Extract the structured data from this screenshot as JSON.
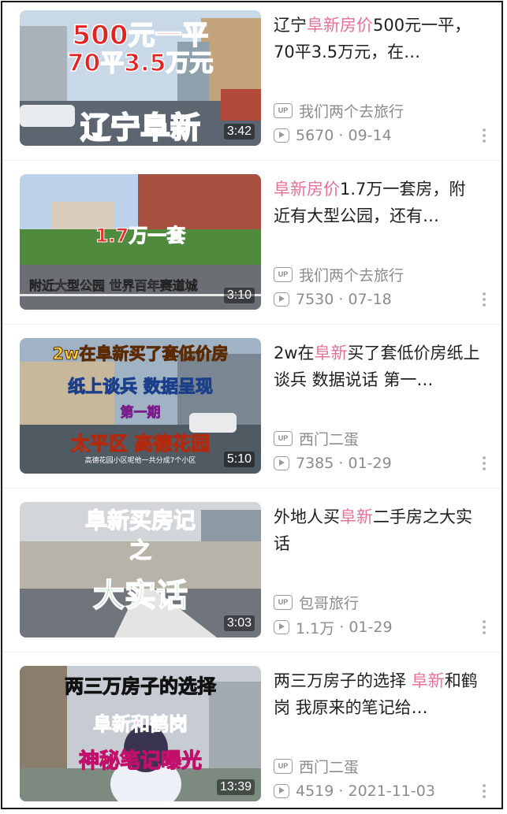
{
  "videos": [
    {
      "thumbnail_captions": [
        "500元一平",
        "70平3.5万元",
        "辽宁阜新"
      ],
      "duration": "3:42",
      "title_parts": [
        {
          "text": "辽宁",
          "highlight": false
        },
        {
          "text": "阜新房价",
          "highlight": true
        },
        {
          "text": "500元一平，70平3.5万元，在…",
          "highlight": false
        }
      ],
      "uploader": "我们两个去旅行",
      "views": "5670",
      "date": "09-14"
    },
    {
      "thumbnail_captions": [
        "1.7万一套",
        "附近大型公园  世界百年赛道城"
      ],
      "duration": "3:10",
      "title_parts": [
        {
          "text": "阜新房价",
          "highlight": true
        },
        {
          "text": "1.7万一套房，附近有大型公园，还有…",
          "highlight": false
        }
      ],
      "uploader": "我们两个去旅行",
      "views": "7530",
      "date": "07-18"
    },
    {
      "thumbnail_captions": [
        "2w在阜新买了套低价房",
        "纸上谈兵  数据呈现",
        "第一期",
        "太平区  高德花园",
        "高德花园小区呢他一共分成7个小区"
      ],
      "duration": "5:10",
      "title_parts": [
        {
          "text": "2w在",
          "highlight": false
        },
        {
          "text": "阜新",
          "highlight": true
        },
        {
          "text": "买了套低价房纸上谈兵 数据说话 第一…",
          "highlight": false
        }
      ],
      "uploader": "西门二蛋",
      "views": "7385",
      "date": "01-29"
    },
    {
      "thumbnail_captions": [
        "阜新买房记",
        "之",
        "大实话"
      ],
      "duration": "3:03",
      "title_parts": [
        {
          "text": "外地人买",
          "highlight": false
        },
        {
          "text": "阜新",
          "highlight": true
        },
        {
          "text": "二手房之大实话",
          "highlight": false
        }
      ],
      "uploader": "包哥旅行",
      "views": "1.1万",
      "date": "01-29"
    },
    {
      "thumbnail_captions": [
        "两三万房子的选择",
        "阜新和鹤岗",
        "神秘笔记曝光"
      ],
      "duration": "13:39",
      "title_parts": [
        {
          "text": "两三万房子的选择 ",
          "highlight": false
        },
        {
          "text": "阜新",
          "highlight": true
        },
        {
          "text": "和鹤岗 我原来的笔记给…",
          "highlight": false
        }
      ],
      "uploader": "西门二蛋",
      "views": "4519",
      "date": "2021-11-03"
    }
  ],
  "meta_separator": " · ",
  "icons": {
    "uploader": "up-icon",
    "views": "play-icon",
    "more": "more-vertical-icon"
  },
  "colors": {
    "highlight": "#e4729a",
    "meta": "#8c8c8c",
    "title": "#1f1f1f"
  }
}
